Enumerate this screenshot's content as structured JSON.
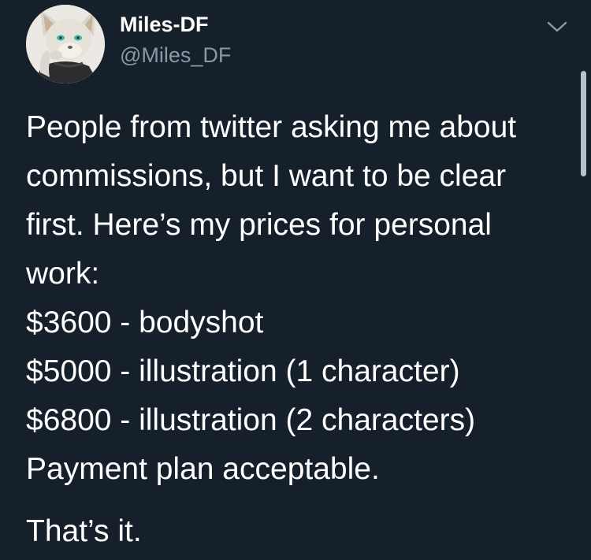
{
  "tweet": {
    "author": {
      "display_name": "Miles-DF",
      "handle": "@Miles_DF",
      "avatar_icon": "fox-character-avatar"
    },
    "menu_icon": "chevron-down-icon",
    "text_lines": [
      "People from twitter asking me about",
      "commissions, but I want to be clear",
      "first. Here’s my prices for personal",
      "work:",
      "$3600 - bodyshot",
      "$5000 - illustration (1 character)",
      "$6800 - illustration (2 characters)",
      "Payment plan acceptable."
    ],
    "closing_line": "That’s it."
  },
  "colors": {
    "background": "#15202b",
    "primary_text": "#ffffff",
    "secondary_text": "#8899a6"
  }
}
